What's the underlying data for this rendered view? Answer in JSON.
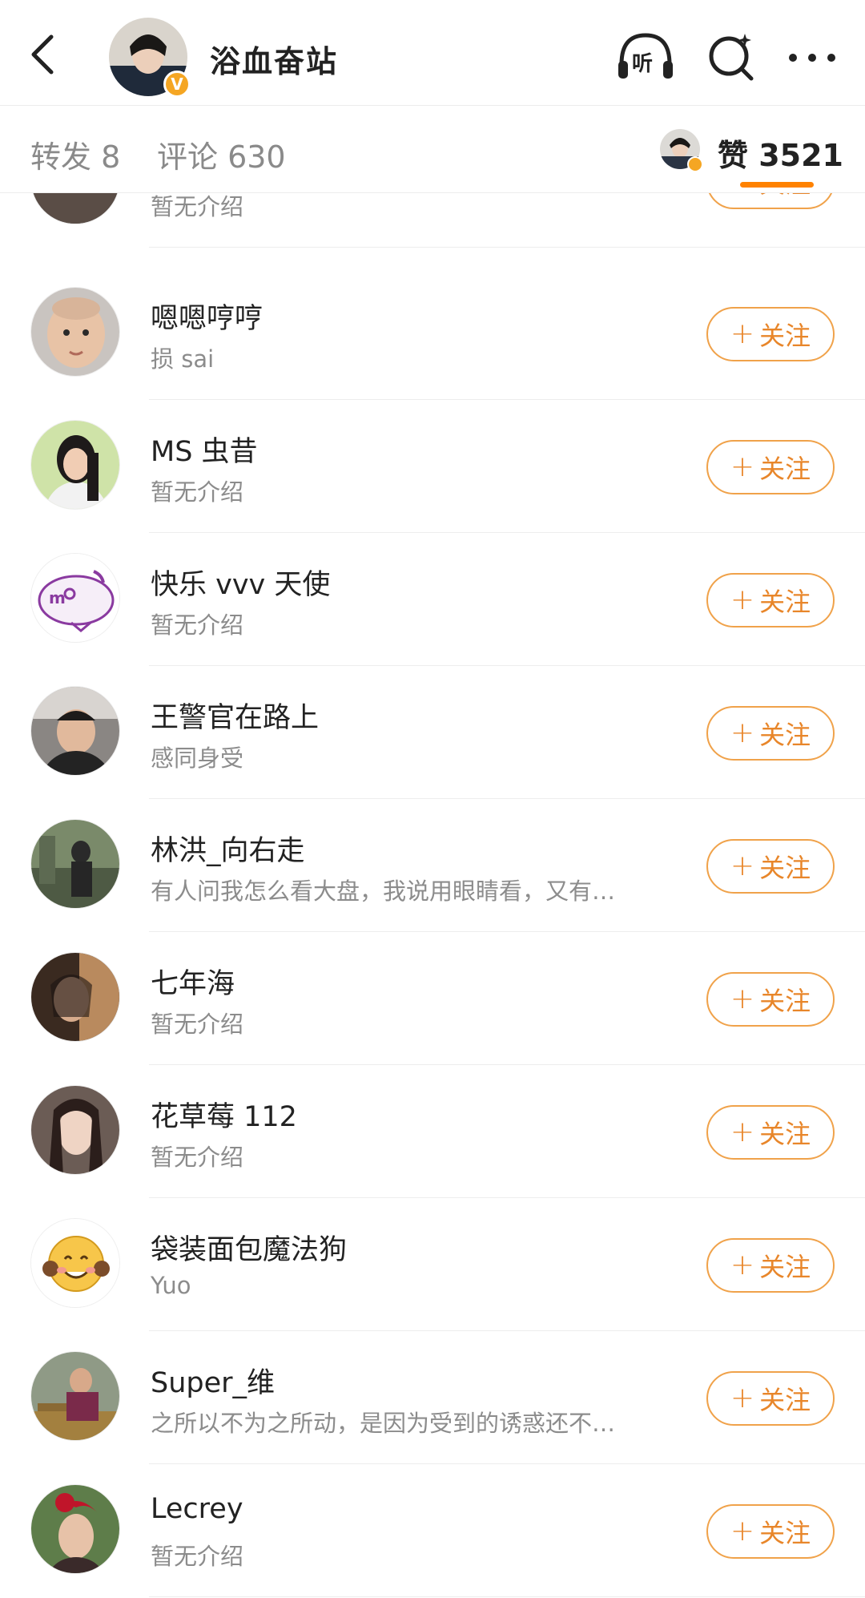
{
  "header": {
    "title": "浴血奋站",
    "verified_badge": "V",
    "icons": [
      "back-icon",
      "listen-icon",
      "search-icon",
      "more-icon"
    ],
    "listen_label": "听"
  },
  "tabs": {
    "repost": "转发 8",
    "comment": "评论 630",
    "like": "赞 3521",
    "active": "like",
    "accent_color": "#ff8200"
  },
  "follow_label": "关注",
  "users": [
    {
      "name": "",
      "bio": "暂无介绍"
    },
    {
      "name": "嗯嗯哼哼",
      "bio": "损 sai"
    },
    {
      "name": "MS 虫昔",
      "bio": "暂无介绍"
    },
    {
      "name": "快乐 vvv 天使",
      "bio": "暂无介绍"
    },
    {
      "name": "王警官在路上",
      "bio": "感同身受"
    },
    {
      "name": "林洪_向右走",
      "bio": "有人问我怎么看大盘，我说用眼睛看，又有…"
    },
    {
      "name": "七年海",
      "bio": "暂无介绍"
    },
    {
      "name": "花草莓 112",
      "bio": "暂无介绍"
    },
    {
      "name": "袋装面包魔法狗",
      "bio": "Yuo"
    },
    {
      "name": "Super_维",
      "bio": "之所以不为之所动，是因为受到的诱惑还不…"
    },
    {
      "name": "Lecrey",
      "bio": "暂无介绍"
    }
  ],
  "colors": {
    "follow_border": "#f0a24a",
    "follow_text": "#e8862a",
    "verified": "#f5a623"
  }
}
